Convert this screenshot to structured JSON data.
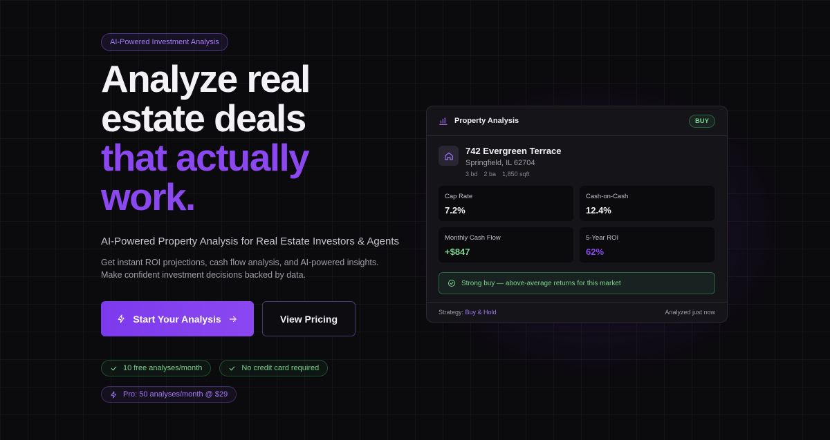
{
  "hero": {
    "tag": "AI-Powered Investment Analysis",
    "headline_lines": [
      "Analyze real",
      "estate deals"
    ],
    "headline_accent_lines": [
      "that actually",
      "work."
    ],
    "subhead": "AI-Powered Property Analysis for Real Estate Investors & Agents",
    "description": "Get instant ROI projections, cash flow analysis, and AI-powered insights. Make confident investment decisions backed by data.",
    "primary_button": "Start Your Analysis",
    "secondary_button": "View Pricing",
    "chips": [
      "10 free analyses/month",
      "No credit card required"
    ],
    "pro_chip": "Pro: 50 analyses/month @ $29"
  },
  "card": {
    "title": "Property Analysis",
    "badge": "BUY",
    "address": "742 Evergreen Terrace",
    "city": "Springfield, IL 62704",
    "specs": [
      "3 bd",
      "2 ba",
      "1,850 sqft"
    ],
    "metrics": [
      {
        "label": "Cap Rate",
        "value": "7.2%"
      },
      {
        "label": "Cash-on-Cash",
        "value": "12.4%"
      },
      {
        "label": "Monthly Cash Flow",
        "value": "+$847"
      },
      {
        "label": "5-Year ROI",
        "value": "62%"
      }
    ],
    "status": "Strong buy — above-average returns for this market",
    "strategy_label": "Strategy:",
    "strategy_value": "Buy & Hold",
    "analyzed": "Analyzed just now"
  },
  "colors": {
    "accent": "#8b47f0",
    "positive": "#7ed38f",
    "background": "#0b0a0d"
  },
  "icons": [
    "bolt-icon",
    "arrow-right-icon",
    "check-icon",
    "bar-chart-icon",
    "home-icon",
    "check-circle-icon"
  ]
}
